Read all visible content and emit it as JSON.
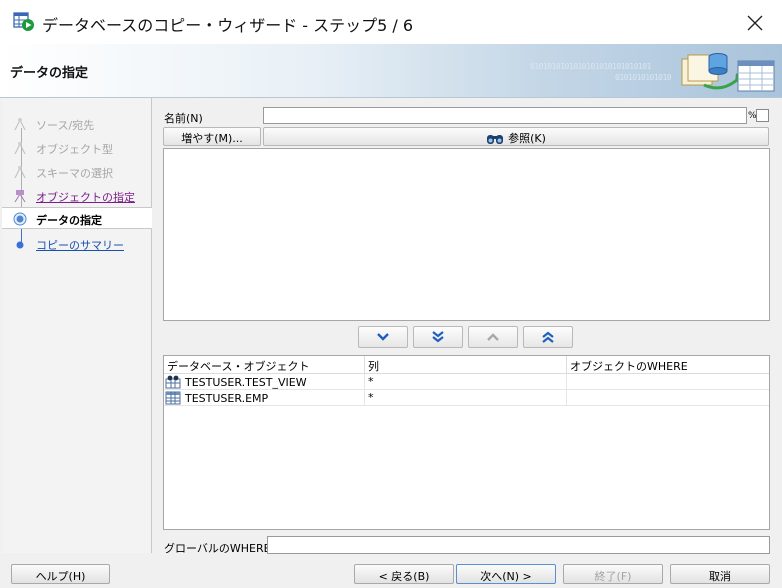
{
  "window": {
    "title": "データベースのコピー・ウィザード - ステップ5 / 6"
  },
  "banner": {
    "title": "データの指定",
    "binary_1": "0101010101010101010101010101",
    "binary_2": "0101010101010"
  },
  "steps": [
    {
      "label": "ソース/宛先",
      "state": "disabled"
    },
    {
      "label": "オブジェクト型",
      "state": "disabled"
    },
    {
      "label": "スキーマの選択",
      "state": "disabled"
    },
    {
      "label": "オブジェクトの指定",
      "state": "visited"
    },
    {
      "label": "データの指定",
      "state": "current"
    },
    {
      "label": "コピーのサマリー",
      "state": "next"
    }
  ],
  "name_field": {
    "label": "名前(N)",
    "value": "",
    "suffix": "%"
  },
  "buttons": {
    "more": "増やす(M)...",
    "browse": "参照(K)"
  },
  "move_buttons": [
    {
      "icon": "chevron-down-icon"
    },
    {
      "icon": "double-chevron-down-icon"
    },
    {
      "icon": "chevron-up-icon"
    },
    {
      "icon": "double-chevron-up-icon"
    }
  ],
  "table": {
    "columns": [
      "データベース・オブジェクト",
      "列",
      "オブジェクトのWHERE"
    ],
    "rows": [
      {
        "icon": "view-icon",
        "object": "TESTUSER.TEST_VIEW",
        "columns": "*",
        "where": ""
      },
      {
        "icon": "table-icon",
        "object": "TESTUSER.EMP",
        "columns": "*",
        "where": ""
      }
    ]
  },
  "global_where": {
    "label": "グローバルのWHERE:",
    "value": ""
  },
  "footer": {
    "help": "ヘルプ(H)",
    "back": "< 戻る(B)",
    "next": "次へ(N) >",
    "finish": "終了(F)",
    "cancel": "取消"
  },
  "colors": {
    "visited_link": "#7a1f8a",
    "next_link": "#1a4fb0",
    "arrow_blue": "#1f5fbf"
  }
}
